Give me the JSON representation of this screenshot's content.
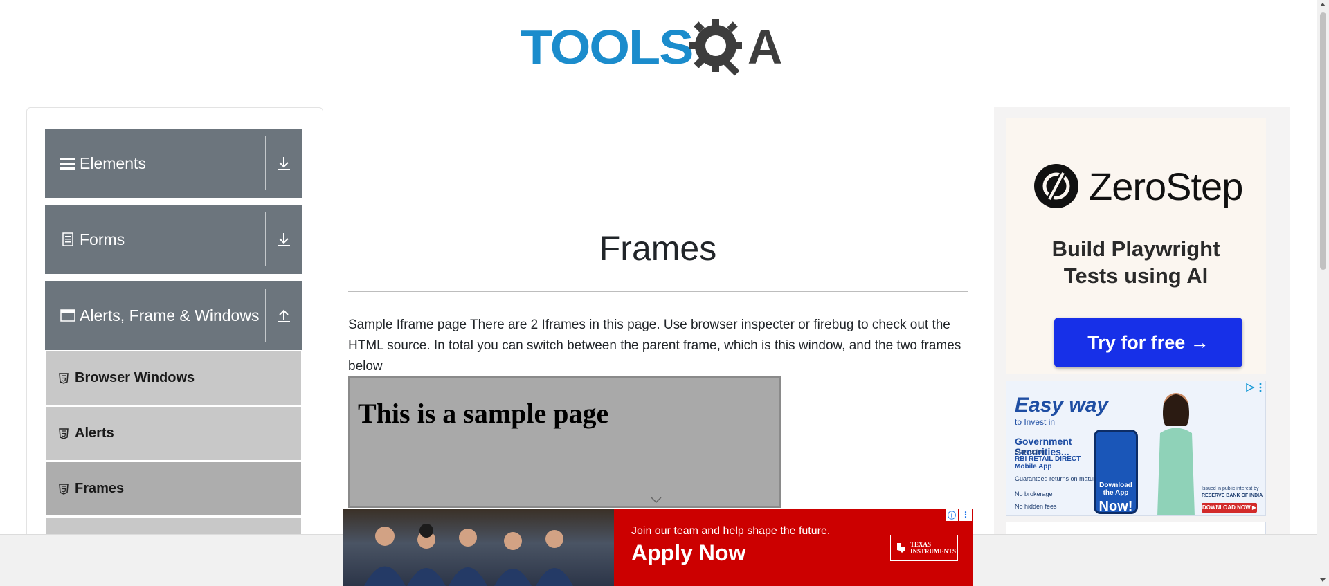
{
  "header": {
    "logo_text": "TOOLS",
    "logo_suffix": "A"
  },
  "sidebar": {
    "groups": [
      {
        "label": "Elements",
        "icon": "hamburger-icon",
        "state": "collapsed"
      },
      {
        "label": "Forms",
        "icon": "document-icon",
        "state": "collapsed"
      },
      {
        "label": "Alerts, Frame & Windows",
        "icon": "window-icon",
        "state": "expanded"
      }
    ],
    "items": [
      {
        "label": "Browser Windows",
        "icon": "html5-icon"
      },
      {
        "label": "Alerts",
        "icon": "html5-icon"
      },
      {
        "label": "Frames",
        "icon": "html5-icon",
        "active": true
      }
    ]
  },
  "main": {
    "title": "Frames",
    "description": "Sample Iframe page There are 2 Iframes in this page. Use browser inspecter or firebug to check out the HTML source. In total you can switch between the parent frame, which is this window, and the two frames below",
    "iframe_heading": "This is a sample page"
  },
  "ad_right": {
    "brand": "ZeroStep",
    "headline_1": "Build Playwright",
    "headline_2": "Tests using AI",
    "cta": "Try for free →"
  },
  "ad_rbi": {
    "title": "Easy way",
    "subtitle_1": "to Invest in",
    "subtitle_2": "Government",
    "subtitle_3": "Securities...",
    "start_using": "Start using",
    "app_name_1": "RBI RETAIL DIRECT",
    "app_name_2": "Mobile App",
    "bullet_1": "Guaranteed returns on maturity",
    "bullet_2": "No brokerage",
    "bullet_3": "No hidden fees",
    "download_1": "Download",
    "download_2": "the App",
    "now": "Now!",
    "issued": "Issued in public interest by",
    "bank": "RESERVE BANK OF INDIA",
    "download_button": "DOWNLOAD NOW ▶"
  },
  "banner": {
    "join_text": "Join our team and help shape the future.",
    "apply_text": "Apply Now",
    "brand_1": "TEXAS",
    "brand_2": "INSTRUMENTS"
  },
  "colors": {
    "sidebar_group": "#6c757d",
    "sidebar_item": "#c8c8c8",
    "sidebar_item_active": "#adadad",
    "logo_blue": "#1b8ccc",
    "cta_blue": "#1730e8",
    "banner_red": "#cc0000"
  }
}
